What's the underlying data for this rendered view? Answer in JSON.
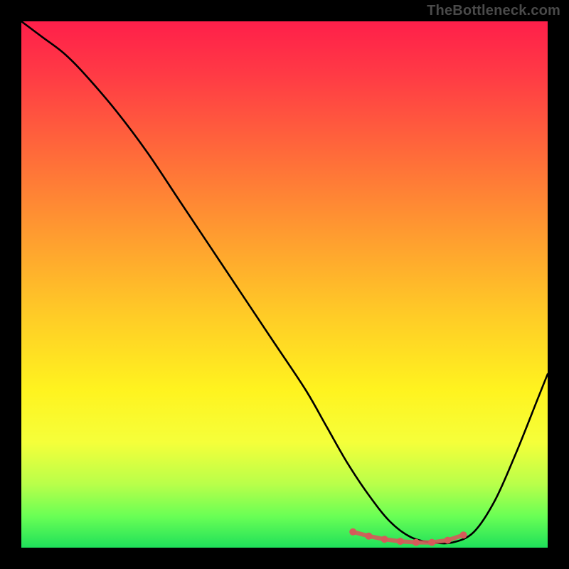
{
  "attribution": "TheBottleneck.com",
  "colors": {
    "background": "#000000",
    "curve": "#000000",
    "marker": "#d65a5a",
    "attribution_text": "#4a4a4a"
  },
  "chart_data": {
    "type": "line",
    "title": "",
    "xlabel": "",
    "ylabel": "",
    "xlim": [
      0,
      100
    ],
    "ylim": [
      0,
      100
    ],
    "series": [
      {
        "name": "bottleneck-curve",
        "x": [
          0,
          4,
          8,
          12,
          18,
          24,
          30,
          36,
          42,
          48,
          54,
          58,
          62,
          66,
          70,
          74,
          78,
          82,
          86,
          90,
          94,
          98,
          100
        ],
        "y": [
          100,
          97,
          94,
          90,
          83,
          75,
          66,
          57,
          48,
          39,
          30,
          23,
          16,
          10,
          5,
          2,
          1,
          1,
          3,
          9,
          18,
          28,
          33
        ]
      }
    ],
    "markers": {
      "name": "minimum-band",
      "x": [
        63,
        66,
        69,
        72,
        75,
        78,
        81,
        84
      ],
      "y": [
        3,
        2.2,
        1.6,
        1.2,
        1.0,
        1.0,
        1.4,
        2.4
      ]
    },
    "gradient_stops": [
      {
        "pos": 0.0,
        "color": "#ff1f4a"
      },
      {
        "pos": 0.25,
        "color": "#ff6a3a"
      },
      {
        "pos": 0.55,
        "color": "#ffc927"
      },
      {
        "pos": 0.8,
        "color": "#f5ff3a"
      },
      {
        "pos": 1.0,
        "color": "#1fe05a"
      }
    ]
  }
}
